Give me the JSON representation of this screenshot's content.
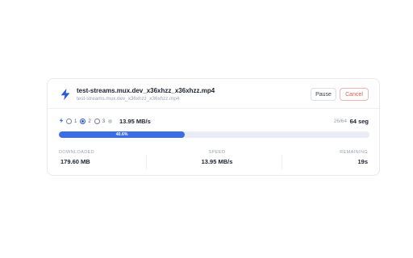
{
  "file": {
    "name": "test-streams.mux.dev_x36xhzz_x36xhzz.mp4",
    "url": "test-streams.mux.dev_x36xhzz_x36xhzz.mp4"
  },
  "actions": {
    "pause_label": "Pause",
    "cancel_label": "Cancel"
  },
  "connections": {
    "options": [
      "1",
      "2",
      "3"
    ],
    "selected": "2"
  },
  "current_speed": "13.95 MB/s",
  "segments": {
    "progress": "26/64",
    "total": "64 seg"
  },
  "progress": {
    "percent": 40.6,
    "label": "40.6%"
  },
  "stats": {
    "downloaded": {
      "label": "DOWNLOADED",
      "value": "179.60 MB"
    },
    "speed": {
      "label": "SPEED",
      "value": "13.95 MB/s"
    },
    "remaining": {
      "label": "REMAINING",
      "value": "19s"
    }
  },
  "colors": {
    "accent": "#3b6de6",
    "danger": "#e0574a"
  }
}
